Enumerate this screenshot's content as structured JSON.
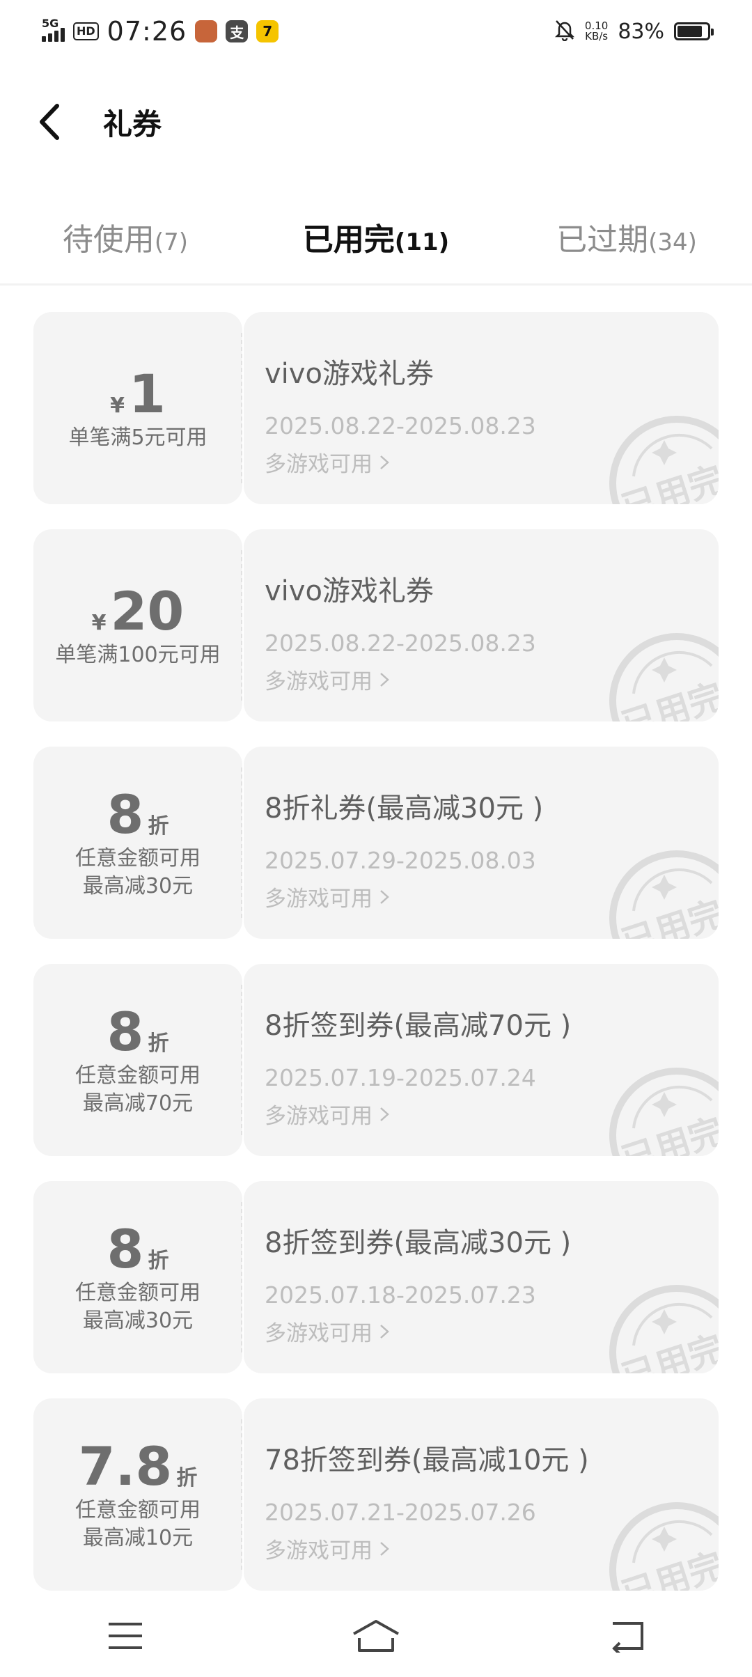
{
  "status_bar": {
    "network": "5G",
    "hd": "HD",
    "time": "07:26",
    "app_icons": [
      {
        "name": "game-app-icon",
        "glyph": "",
        "color": "#c7653a"
      },
      {
        "name": "alipay-app-icon",
        "glyph": "支",
        "color": "#4a4a4a"
      },
      {
        "name": "seven-app-icon",
        "glyph": "7",
        "color": "#f5c400"
      }
    ],
    "speed_value": "0.10",
    "speed_unit": "KB/s",
    "battery": "83%"
  },
  "header": {
    "title": "礼券"
  },
  "tabs": [
    {
      "label": "待使用",
      "count": "(7)",
      "active": false
    },
    {
      "label": "已用完",
      "count": "(11)",
      "active": true
    },
    {
      "label": "已过期",
      "count": "(34)",
      "active": false
    }
  ],
  "accent_color": "#ff7d2a",
  "stamp_text": "已用完",
  "coupons": [
    {
      "kind": "money",
      "symbol": "¥",
      "amount": "1",
      "cond1": "单笔满5元可用",
      "cond2": "",
      "title": "vivo游戏礼券",
      "date": "2025.08.22-2025.08.23",
      "scope": "多游戏可用"
    },
    {
      "kind": "money",
      "symbol": "¥",
      "amount": "20",
      "cond1": "单笔满100元可用",
      "cond2": "",
      "title": "vivo游戏礼券",
      "date": "2025.08.22-2025.08.23",
      "scope": "多游戏可用"
    },
    {
      "kind": "discount",
      "amount": "8",
      "unit": "折",
      "cond1": "任意金额可用",
      "cond2": "最高减30元",
      "title": "8折礼券(最高减30元 )",
      "date": "2025.07.29-2025.08.03",
      "scope": "多游戏可用"
    },
    {
      "kind": "discount",
      "amount": "8",
      "unit": "折",
      "cond1": "任意金额可用",
      "cond2": "最高减70元",
      "title": "8折签到券(最高减70元 )",
      "date": "2025.07.19-2025.07.24",
      "scope": "多游戏可用"
    },
    {
      "kind": "discount",
      "amount": "8",
      "unit": "折",
      "cond1": "任意金额可用",
      "cond2": "最高减30元",
      "title": "8折签到券(最高减30元 )",
      "date": "2025.07.18-2025.07.23",
      "scope": "多游戏可用"
    },
    {
      "kind": "discount",
      "amount": "7.8",
      "unit": "折",
      "cond1": "任意金额可用",
      "cond2": "最高减10元",
      "title": "78折签到券(最高减10元 )",
      "date": "2025.07.21-2025.07.26",
      "scope": "多游戏可用"
    }
  ]
}
